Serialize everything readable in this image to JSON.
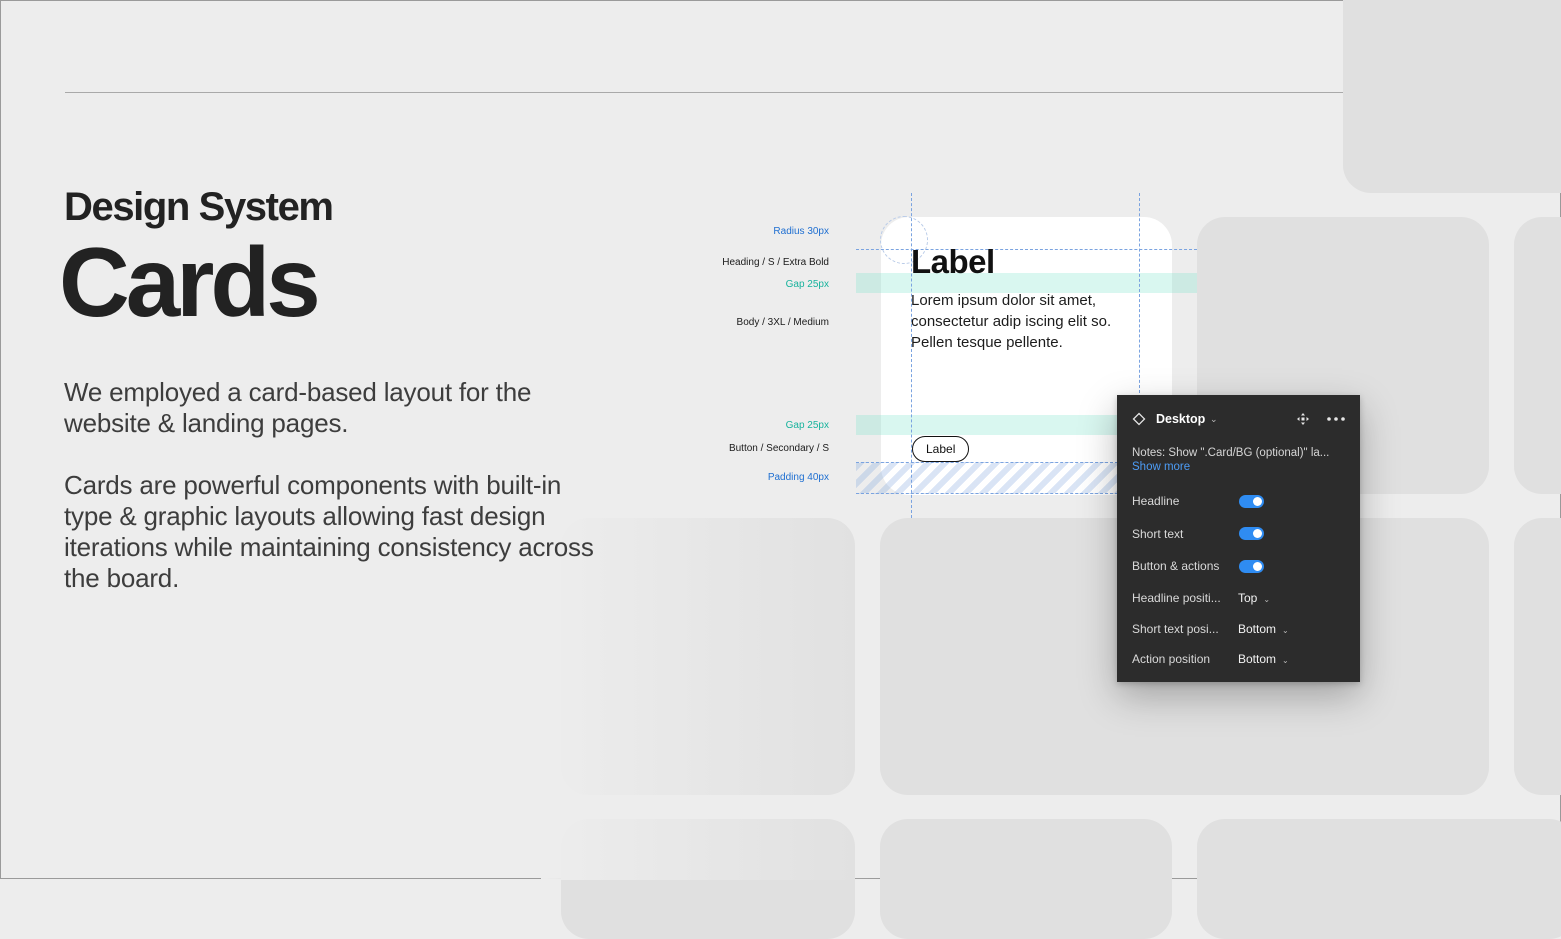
{
  "header": {
    "eyebrow": "Design System",
    "title": "Cards"
  },
  "intro": {
    "paragraph_1": "We employed a card-based layout for the website & landing pages.",
    "paragraph_2": "Cards are powerful components with built-in type & graphic layouts allowing fast design iterations while maintaining consistency across the board."
  },
  "specs": {
    "radius": "Radius 30px",
    "heading_style": "Heading / S / Extra Bold",
    "gap_top": "Gap 25px",
    "body_style": "Body / 3XL / Medium",
    "gap_bottom": "Gap 25px",
    "button_style": "Button / Secondary / S",
    "padding": "Padding 40px"
  },
  "card": {
    "heading": "Label",
    "body": "Lorem ipsum dolor sit amet, consectetur adip iscing elit so. Pellen tesque pellente.",
    "button_label": "Label"
  },
  "panel": {
    "title": "Desktop",
    "notes": "Notes: Show \".Card/BG (optional)\" la...",
    "show_more": "Show more",
    "toggles": [
      {
        "label": "Headline",
        "on": true
      },
      {
        "label": "Short text",
        "on": true
      },
      {
        "label": "Button & actions",
        "on": true
      }
    ],
    "selects": [
      {
        "label": "Headline positi...",
        "value": "Top"
      },
      {
        "label": "Short text posi...",
        "value": "Bottom"
      },
      {
        "label": "Action position",
        "value": "Bottom"
      }
    ]
  },
  "colors": {
    "background": "#ededed",
    "spec_blue": "#1f6fd1",
    "spec_teal": "#18b39d",
    "panel_bg": "#2c2c2c",
    "toggle_on": "#2f8cf2",
    "link": "#4d9cf5"
  }
}
